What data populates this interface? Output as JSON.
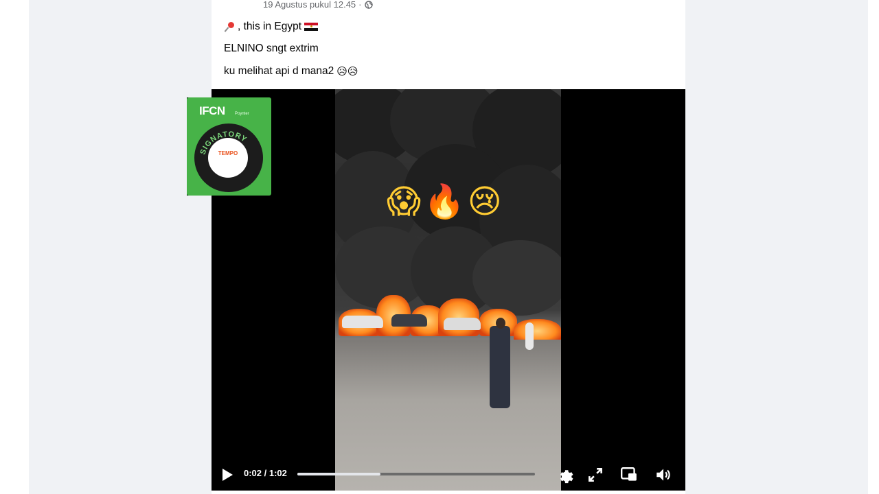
{
  "post": {
    "timestamp": "19 Agustus pukul 12.45",
    "timestamp_separator": "·",
    "lines": [
      {
        "emoji": "pushpin",
        "text": ", this in Egypt",
        "flag": "egypt-flag"
      },
      {
        "text": "ELNINO sngt extrim"
      },
      {
        "text": "ku melihat api d mana2",
        "emojis": "😥😥"
      }
    ]
  },
  "video": {
    "overlay_emojis": "😱🔥😢",
    "time_display": "0:02 / 1:02",
    "progress": 0.35,
    "controls": [
      "play-icon",
      "settings-gear-icon",
      "fullscreen-icon",
      "picture-in-picture-icon",
      "volume-icon"
    ]
  },
  "badge": {
    "title": "IFCN",
    "subtitle": "Poynter",
    "ring_text": "SIGNATORY",
    "center_logo": "TEMPO",
    "colors": {
      "green": "#47b348",
      "ring": "#1c1c1c",
      "logo": "#e9501b"
    }
  },
  "colors": {
    "page_bg": "#f0f2f5",
    "card_bg": "#ffffff",
    "text": "#050505",
    "meta_text": "#65676b"
  }
}
